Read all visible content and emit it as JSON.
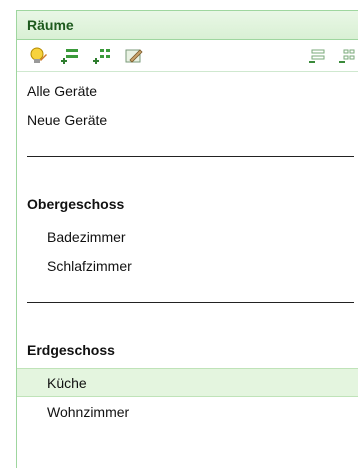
{
  "panel": {
    "title": "Räume"
  },
  "toolbar": {
    "left_icons": [
      "lightbulb-edit-icon",
      "add-room-icon",
      "add-group-icon",
      "edit-icon"
    ],
    "right_icons": [
      "collapse-list-icon",
      "expand-list-icon"
    ]
  },
  "list": {
    "all_devices": "Alle Geräte",
    "new_devices": "Neue Geräte",
    "groups": [
      {
        "name": "Obergeschoss",
        "rooms": [
          "Badezimmer",
          "Schlafzimmer"
        ]
      },
      {
        "name": "Erdgeschoss",
        "rooms": [
          "Küche",
          "Wohnzimmer"
        ]
      }
    ],
    "selected": "Küche"
  },
  "colors": {
    "accent_green": "#9fd69f",
    "header_text": "#1e5a1e",
    "selected_bg": "#e4f5df"
  }
}
